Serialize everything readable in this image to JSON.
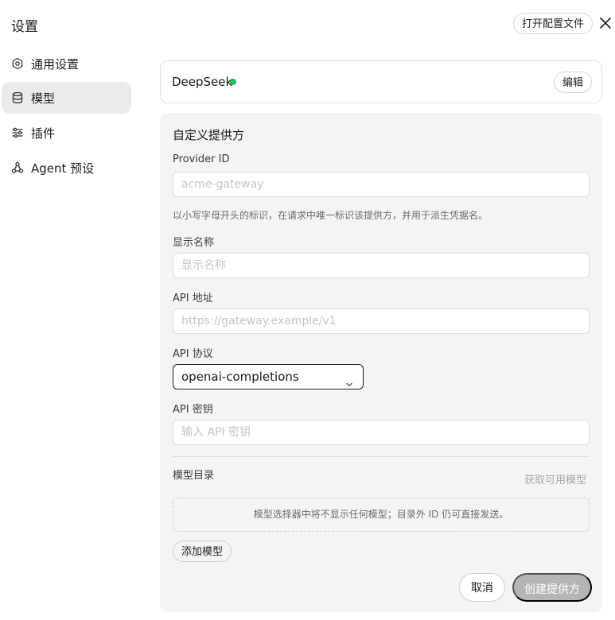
{
  "window": {
    "title": "设置",
    "open_config_label": "打开配置文件",
    "close_icon": "close-icon"
  },
  "sidebar": {
    "items": [
      {
        "label": "通用设置",
        "icon": "gear-icon",
        "active": false
      },
      {
        "label": "模型",
        "icon": "database-icon",
        "active": true
      },
      {
        "label": "插件",
        "icon": "sliders-icon",
        "active": false
      },
      {
        "label": "Agent 预设",
        "icon": "agent-icon",
        "active": false
      }
    ]
  },
  "provider_card": {
    "name": "DeepSeek",
    "status_color": "#1fbf5c",
    "edit_label": "编辑"
  },
  "form": {
    "title": "自定义提供方",
    "provider_id": {
      "label": "Provider ID",
      "placeholder": "acme-gateway",
      "value": "",
      "help": "以小写字母开头的标识，在请求中唯一标识该提供方，并用于派生凭据名。"
    },
    "display_name": {
      "label": "显示名称",
      "placeholder": "显示名称",
      "value": ""
    },
    "api_address": {
      "label": "API 地址",
      "placeholder": "https://gateway.example/v1",
      "value": ""
    },
    "api_protocol": {
      "label": "API 协议",
      "selected": "openai-completions"
    },
    "api_key": {
      "label": "API 密钥",
      "placeholder": "输入 API 密钥",
      "value": ""
    },
    "model_catalog": {
      "label": "模型目录",
      "fetch_label": "获取可用模型",
      "empty_text": "模型选择器中将不显示任何模型；目录外 ID 仍可直接发送。",
      "add_label": "添加模型"
    },
    "cancel_label": "取消",
    "create_label": "创建提供方"
  }
}
